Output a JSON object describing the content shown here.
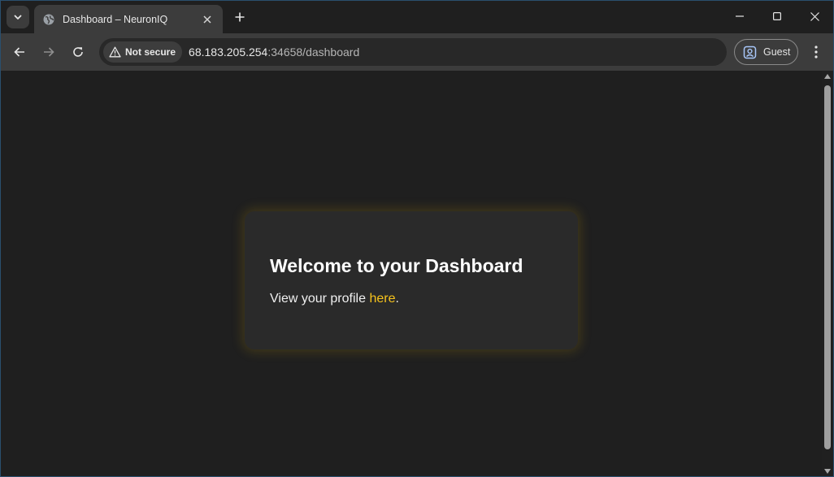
{
  "browser": {
    "tab": {
      "title": "Dashboard – NeuronIQ"
    },
    "security_chip": "Not secure",
    "url": {
      "host": "68.183.205.254",
      "rest": ":34658/dashboard"
    },
    "profile_label": "Guest"
  },
  "page": {
    "heading": "Welcome to your Dashboard",
    "profile_text_before": "View your profile ",
    "profile_link": "here",
    "profile_text_after": ".",
    "accent_color": "#f7c31b"
  }
}
